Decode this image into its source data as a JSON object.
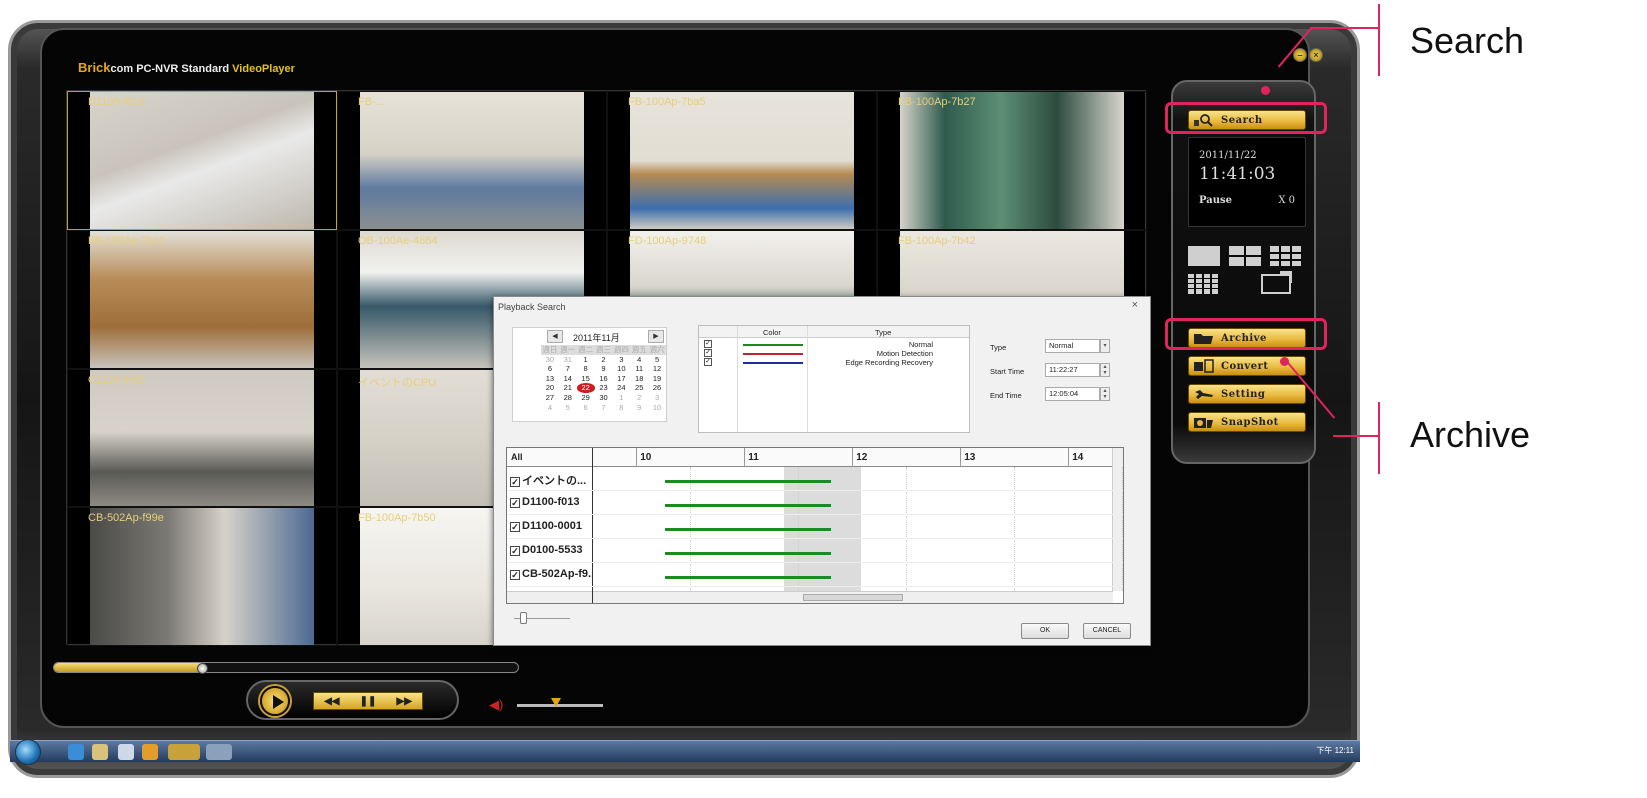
{
  "app": {
    "brand_part1": "Brick",
    "brand_part2": "com PC-NVR Standard ",
    "brand_part3": "VideoPlayer",
    "minimize_glyph": "–",
    "close_glyph": "×"
  },
  "cameras": [
    {
      "label": "D1100-f013",
      "selected": true,
      "scene": "ceiling"
    },
    {
      "label": "FB-...",
      "scene": "office"
    },
    {
      "label": "FB-100Ap-7ba5",
      "scene": "room"
    },
    {
      "label": "FB-100Ap-7b27",
      "scene": "window"
    },
    {
      "label": "FB-100Ap-7bc1",
      "scene": "board"
    },
    {
      "label": "OB-100Ae-4864",
      "scene": "building"
    },
    {
      "label": "FD-100Ap-9748",
      "scene": "corridor"
    },
    {
      "label": "FB-100Ap-7b42",
      "scene": "hall"
    },
    {
      "label": "C1100-4fd5",
      "scene": "lamp"
    },
    {
      "label": "イベントのCPU",
      "scene": "wall"
    },
    {
      "label": "",
      "scene": "blank"
    },
    {
      "label": "",
      "scene": "blank"
    },
    {
      "label": "CB-502Ap-f99e",
      "scene": "closet"
    },
    {
      "label": "FB-100Ap-7b50",
      "scene": "bright"
    },
    {
      "label": "",
      "scene": "blank"
    },
    {
      "label": "",
      "scene": "blank"
    }
  ],
  "panel": {
    "search_label": "Search",
    "date": "2011/11/22",
    "time": "11:41:03",
    "status": "Pause",
    "speed": "X 0",
    "archive_label": "Archive",
    "convert_label": "Convert",
    "setting_label": "Setting",
    "snapshot_label": "SnapShot"
  },
  "annotations": {
    "search": "Search",
    "archive": "Archive"
  },
  "dialog": {
    "title": "Playback Search",
    "close": "×",
    "calendar": {
      "prev": "◀",
      "next": "▶",
      "month": "2011年11月",
      "weekdays": [
        "週日",
        "週一",
        "週二",
        "週三",
        "週四",
        "週五",
        "週六"
      ],
      "days": [
        {
          "d": "30",
          "dim": true
        },
        {
          "d": "31",
          "dim": true
        },
        {
          "d": "1"
        },
        {
          "d": "2"
        },
        {
          "d": "3"
        },
        {
          "d": "4"
        },
        {
          "d": "5"
        },
        {
          "d": "6"
        },
        {
          "d": "7"
        },
        {
          "d": "8"
        },
        {
          "d": "9"
        },
        {
          "d": "10"
        },
        {
          "d": "11"
        },
        {
          "d": "12"
        },
        {
          "d": "13"
        },
        {
          "d": "14"
        },
        {
          "d": "15"
        },
        {
          "d": "16"
        },
        {
          "d": "17"
        },
        {
          "d": "18"
        },
        {
          "d": "19"
        },
        {
          "d": "20"
        },
        {
          "d": "21"
        },
        {
          "d": "22",
          "today": true
        },
        {
          "d": "23"
        },
        {
          "d": "24"
        },
        {
          "d": "25"
        },
        {
          "d": "26"
        },
        {
          "d": "27"
        },
        {
          "d": "28"
        },
        {
          "d": "29"
        },
        {
          "d": "30"
        },
        {
          "d": "1",
          "dim": true
        },
        {
          "d": "2",
          "dim": true
        },
        {
          "d": "3",
          "dim": true
        },
        {
          "d": "4",
          "dim": true
        },
        {
          "d": "5",
          "dim": true
        },
        {
          "d": "6",
          "dim": true
        },
        {
          "d": "7",
          "dim": true
        },
        {
          "d": "8",
          "dim": true
        },
        {
          "d": "9",
          "dim": true
        },
        {
          "d": "10",
          "dim": true
        }
      ]
    },
    "type_table": {
      "col_color": "Color",
      "col_type": "Type",
      "rows": [
        {
          "checked": true,
          "color": "#1f8a1f",
          "type": "Normal"
        },
        {
          "checked": true,
          "color": "#c0242b",
          "type": "Motion Detection"
        },
        {
          "checked": true,
          "color": "#1d2f99",
          "type": "Edge Recording Recovery"
        }
      ]
    },
    "form": {
      "type_label": "Type",
      "type_value": "Normal",
      "start_label": "Start Time",
      "start_value": "11:22:27",
      "end_label": "End Time",
      "end_value": "12:05:04"
    },
    "timeline": {
      "all_label": "All",
      "hours": [
        "10",
        "11",
        "12",
        "13",
        "14"
      ],
      "rows": [
        {
          "name": "イベントの...",
          "start": 10.27,
          "end": 11.8
        },
        {
          "name": "D1100-f013",
          "start": 10.27,
          "end": 11.8
        },
        {
          "name": "D1100-0001",
          "start": 10.27,
          "end": 11.8
        },
        {
          "name": "D0100-5533",
          "start": 10.27,
          "end": 11.8
        },
        {
          "name": "CB-502Ap-f9...",
          "start": 10.27,
          "end": 11.8
        }
      ],
      "selection_start": 11.37,
      "selection_end": 12.08
    },
    "ok_label": "OK",
    "cancel_label": "CANCEL"
  },
  "player": {
    "progress": 0.32,
    "rewind": "◀◀",
    "pause": "❚❚",
    "forward": "▶▶",
    "volume_icon": "◀)",
    "volume": 0.45
  },
  "taskbar": {
    "tray_text": "下午 12:11"
  }
}
